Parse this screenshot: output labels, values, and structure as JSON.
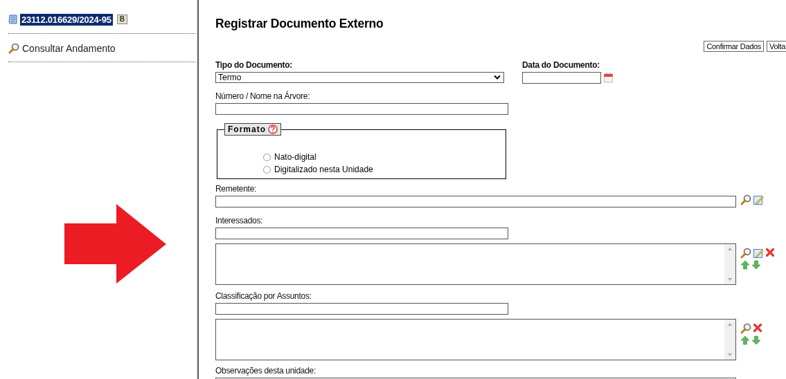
{
  "sidebar": {
    "process": {
      "number": "23112.016629/2024-95",
      "badge": "B",
      "selected": true
    },
    "items": [
      {
        "label": "Consultar Andamento"
      }
    ]
  },
  "form": {
    "title": "Registrar Documento Externo",
    "buttons": [
      "Confirmar Dados",
      "Volta"
    ],
    "tipo_documento": {
      "label": "Tipo do Documento:",
      "value": "Termo"
    },
    "data_documento": {
      "label": "Data do Documento:"
    },
    "numero": {
      "label": "Número / Nome na Árvore:"
    },
    "formato": {
      "legend": "Formato",
      "options": [
        {
          "label": "Nato-digital",
          "selected": false
        },
        {
          "label": "Digitalizado nesta Unidade",
          "selected": false
        }
      ]
    },
    "remetente": {
      "label": "Remetente:",
      "actions": [
        {
          "kind": "search"
        },
        {
          "kind": "edit"
        }
      ]
    },
    "lists": [
      {
        "label": "Interessados:",
        "actions": [
          {
            "kind": "search"
          },
          {
            "kind": "edit"
          },
          {
            "kind": "remove"
          }
        ]
      },
      {
        "label": "Classificação por Assuntos:",
        "actions": [
          {
            "kind": "search"
          },
          {
            "kind": "remove"
          }
        ]
      }
    ],
    "observacoes": {
      "label": "Observações desta unidade:"
    }
  }
}
